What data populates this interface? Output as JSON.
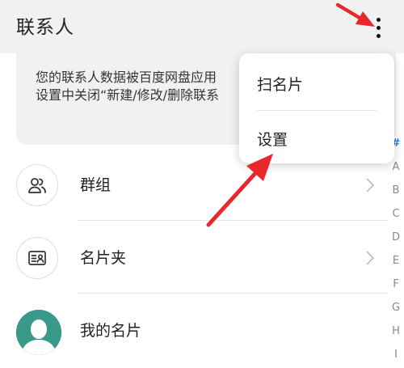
{
  "header": {
    "title": "联系人"
  },
  "notice": {
    "line1": "您的联系人数据被百度网盘应用",
    "line2": "设置中关闭“新建/修改/删除联系"
  },
  "menu": {
    "items": [
      {
        "label": "扫名片"
      },
      {
        "label": "设置"
      }
    ]
  },
  "list": {
    "items": [
      {
        "label": "群组",
        "icon": "group-icon"
      },
      {
        "label": "名片夹",
        "icon": "card-holder-icon"
      },
      {
        "label": "我的名片",
        "icon": "avatar-icon"
      }
    ]
  },
  "index_bar": {
    "letters": [
      "#",
      "A",
      "B",
      "C",
      "D",
      "E",
      "F",
      "G",
      "H",
      "I"
    ],
    "active": "#"
  },
  "colors": {
    "header_bg": "#f1f1f1",
    "annotation_arrow": "#e8282b",
    "index_active": "#2b7ff0",
    "avatar_bg": "#3a9a8a"
  }
}
